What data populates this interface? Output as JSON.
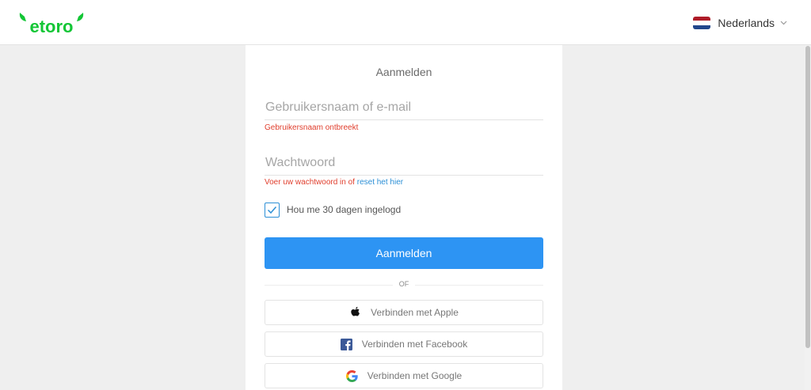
{
  "header": {
    "logo_text": "etoro",
    "language": {
      "label": "Nederlands",
      "flag_colors": [
        "#ae1c28",
        "#ffffff",
        "#21468b"
      ]
    }
  },
  "login": {
    "title": "Aanmelden",
    "username_placeholder": "Gebruikersnaam of e-mail",
    "username_error": "Gebruikersnaam ontbreekt",
    "password_placeholder": "Wachtwoord",
    "password_error_prefix": "Voer uw wachtwoord in of ",
    "password_error_link": "reset het hier",
    "remember_label": "Hou me 30 dagen ingelogd",
    "remember_checked": true,
    "submit_label": "Aanmelden",
    "divider_label": "OF",
    "social": [
      {
        "label": "Verbinden met Apple",
        "icon": "apple-icon"
      },
      {
        "label": "Verbinden met Facebook",
        "icon": "facebook-icon"
      },
      {
        "label": "Verbinden met Google",
        "icon": "google-icon"
      }
    ]
  },
  "colors": {
    "brand_green": "#13c636",
    "primary_button": "#2d94f3",
    "error": "#e03e2d",
    "link": "#2c8fd6"
  }
}
